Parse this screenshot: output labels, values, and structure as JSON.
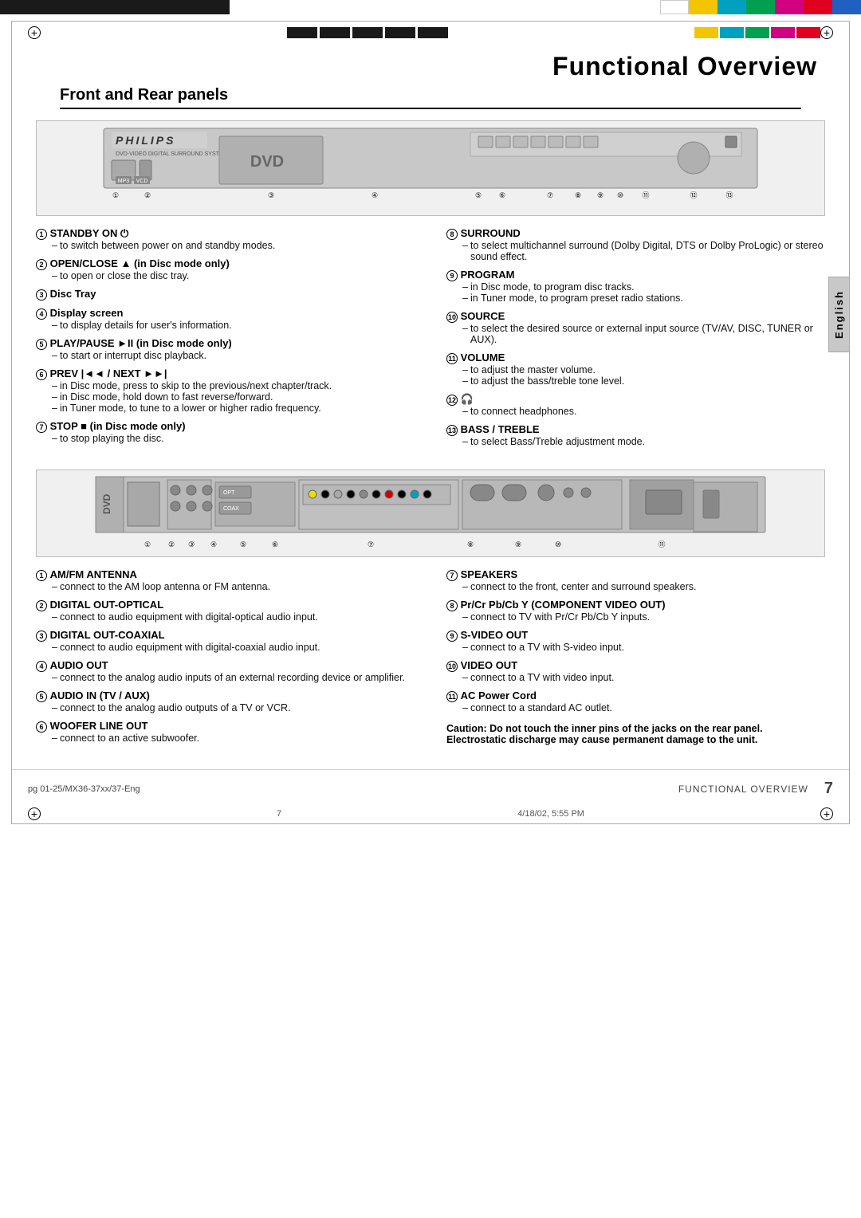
{
  "page": {
    "title": "Functional Overview",
    "section_title": "Front and Rear panels",
    "tab_label": "English",
    "footer_label": "Functional Overview",
    "page_number": "7",
    "footer_left": "pg 01-25/MX36-37xx/37-Eng",
    "footer_center": "7",
    "footer_right": "4/18/02, 5:55 PM"
  },
  "top_color_blocks": [
    "black",
    "black",
    "black",
    "black",
    "black",
    "black",
    "black",
    "black",
    "white",
    "yellow",
    "cyan",
    "green",
    "magenta",
    "red",
    "blue"
  ],
  "front_panel": {
    "numbers": [
      "1",
      "2",
      "3",
      "4",
      "5",
      "6",
      "7",
      "8",
      "9",
      "10",
      "11",
      "12",
      "13"
    ]
  },
  "rear_panel": {
    "numbers_left": [
      "1",
      "2",
      "3",
      "4",
      "5",
      "6",
      "7"
    ],
    "numbers_right": [
      "8",
      "9",
      "10",
      "11"
    ]
  },
  "front_items": [
    {
      "num": "1",
      "title": "STANDBY ON ⏻",
      "descs": [
        "to switch between power on and standby modes."
      ]
    },
    {
      "num": "2",
      "title": "OPEN/CLOSE ▲ (in Disc mode only)",
      "descs": [
        "to open or close the disc tray."
      ]
    },
    {
      "num": "3",
      "title": "Disc Tray",
      "descs": []
    },
    {
      "num": "4",
      "title": "Display screen",
      "descs": [
        "to display details for user's information."
      ]
    },
    {
      "num": "5",
      "title": "PLAY/PAUSE ►II (in Disc mode only)",
      "descs": [
        "to start or interrupt disc playback."
      ]
    },
    {
      "num": "6",
      "title": "PREV |◄◄ / NEXT ►►|",
      "descs": [
        "in Disc mode, press to skip to the previous/next chapter/track.",
        "in Disc mode, hold down to fast reverse/forward.",
        "in Tuner mode, to tune to a lower or higher radio frequency."
      ]
    },
    {
      "num": "7",
      "title": "STOP ■ (in Disc mode only)",
      "descs": [
        "to stop playing the disc."
      ]
    },
    {
      "num": "8",
      "title": "SURROUND",
      "descs": [
        "to select multichannel surround (Dolby Digital, DTS or Dolby ProLogic) or stereo sound effect."
      ]
    },
    {
      "num": "9",
      "title": "PROGRAM",
      "descs": [
        "in Disc mode, to program disc tracks.",
        "in Tuner mode, to program preset radio stations."
      ]
    },
    {
      "num": "10",
      "title": "SOURCE",
      "descs": [
        "to select the desired source or external input source (TV/AV, DISC, TUNER or AUX)."
      ]
    },
    {
      "num": "11",
      "title": "VOLUME",
      "descs": [
        "to adjust the master volume.",
        "to adjust the bass/treble tone level."
      ]
    },
    {
      "num": "12",
      "title": "🎧",
      "descs": [
        "to connect headphones."
      ]
    },
    {
      "num": "13",
      "title": "BASS / TREBLE",
      "descs": [
        "to select Bass/Treble adjustment mode."
      ]
    }
  ],
  "rear_items_left": [
    {
      "num": "1",
      "title": "AM/FM ANTENNA",
      "descs": [
        "connect to the AM loop antenna or FM antenna."
      ]
    },
    {
      "num": "2",
      "title": "DIGITAL OUT-OPTICAL",
      "descs": [
        "connect to audio equipment with digital-optical audio input."
      ]
    },
    {
      "num": "3",
      "title": "DIGITAL OUT-COAXIAL",
      "descs": [
        "connect to audio equipment with digital-coaxial audio input."
      ]
    },
    {
      "num": "4",
      "title": "AUDIO OUT",
      "descs": [
        "connect to the analog audio inputs of an external recording device or amplifier."
      ]
    },
    {
      "num": "5",
      "title": "AUDIO IN (TV / AUX)",
      "descs": [
        "connect to the analog audio outputs of a TV or VCR."
      ]
    },
    {
      "num": "6",
      "title": "WOOFER LINE OUT",
      "descs": [
        "connect to an active subwoofer."
      ]
    }
  ],
  "rear_items_right": [
    {
      "num": "7",
      "title": "SPEAKERS",
      "descs": [
        "connect to the front, center and surround speakers."
      ]
    },
    {
      "num": "8",
      "title": "Pr/Cr Pb/Cb Y (COMPONENT VIDEO OUT)",
      "descs": [
        "connect to TV with Pr/Cr Pb/Cb Y inputs."
      ]
    },
    {
      "num": "9",
      "title": "S-VIDEO OUT",
      "descs": [
        "connect to a TV with S-video input."
      ]
    },
    {
      "num": "10",
      "title": "VIDEO OUT",
      "descs": [
        "connect to a TV with video input."
      ]
    },
    {
      "num": "11",
      "title": "AC Power Cord",
      "descs": [
        "connect to a standard AC outlet."
      ]
    }
  ],
  "caution": {
    "text": "Caution: Do not touch the inner pins of the jacks on the rear panel. Electrostatic discharge may cause permanent damage to the unit."
  }
}
